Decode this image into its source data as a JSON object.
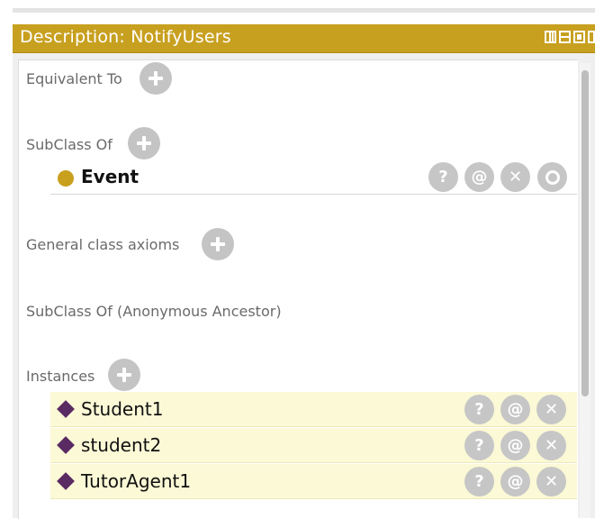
{
  "window": {
    "title": "Description: NotifyUsers",
    "controls": [
      "float-icon",
      "minimize-icon",
      "maximize-icon",
      "close-icon"
    ]
  },
  "sections": {
    "equivalent_to": "Equivalent To",
    "subclass_of": "SubClass Of",
    "general_class_axioms": "General class axioms",
    "subclass_of_anonymous": "SubClass Of (Anonymous Ancestor)",
    "instances": "Instances"
  },
  "superclasses": [
    {
      "label": "Event",
      "icon": "class-circle-icon",
      "color": "#c9a01e"
    }
  ],
  "instances": [
    {
      "label": "Student1",
      "icon": "individual-diamond-icon",
      "color": "#5a2a62"
    },
    {
      "label": "student2",
      "icon": "individual-diamond-icon",
      "color": "#5a2a62"
    },
    {
      "label": "TutorAgent1",
      "icon": "individual-diamond-icon",
      "color": "#5a2a62"
    }
  ],
  "row_buttons": {
    "explain": "?",
    "annotate": "@",
    "delete": "✕"
  },
  "colors": {
    "title_bar": "#c8a020",
    "instance_row_bg": "#fbf9d6",
    "button_gray": "#c6c6c6"
  }
}
